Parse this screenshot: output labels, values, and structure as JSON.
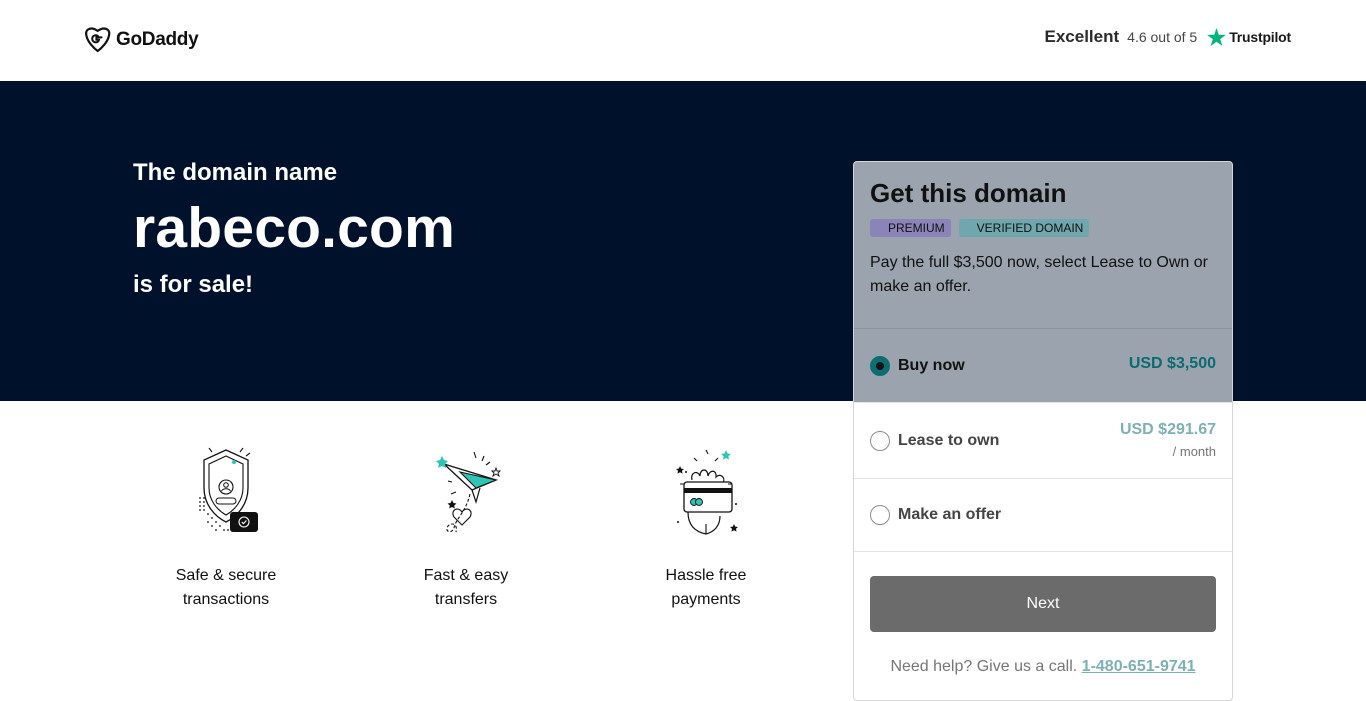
{
  "header": {
    "logo_text": "GoDaddy",
    "rating_word": "Excellent",
    "rating_score": "4.6 out of 5",
    "rating_provider": "Trustpilot"
  },
  "hero": {
    "lead": "The domain name",
    "domain": "rabeco.com",
    "tail": "is for sale!"
  },
  "features": [
    {
      "label": "Safe & secure transactions",
      "icon": "shield-icon"
    },
    {
      "label": "Fast & easy transfers",
      "icon": "paper-plane-icon"
    },
    {
      "label": "Hassle free payments",
      "icon": "card-hand-icon"
    }
  ],
  "card": {
    "title": "Get this domain",
    "badges": [
      "PREMIUM",
      "VERIFIED DOMAIN"
    ],
    "description": "Pay the full $3,500 now, select Lease to Own or make an offer.",
    "options": [
      {
        "label": "Buy now",
        "price": "USD $3,500",
        "selected": true
      },
      {
        "label": "Lease to own",
        "price": "USD $291.67",
        "sub": "/ month",
        "selected": false
      },
      {
        "label": "Make an offer",
        "selected": false
      }
    ],
    "next_label": "Next",
    "help_text": "Need help? Give us a call.",
    "help_phone": "1-480-651-9741"
  },
  "colors": {
    "hero_bg": "#00112c",
    "card_head_bg": "#9ba3ae",
    "accent_teal": "#0b6b70",
    "button_bg": "#6b6b6b"
  }
}
